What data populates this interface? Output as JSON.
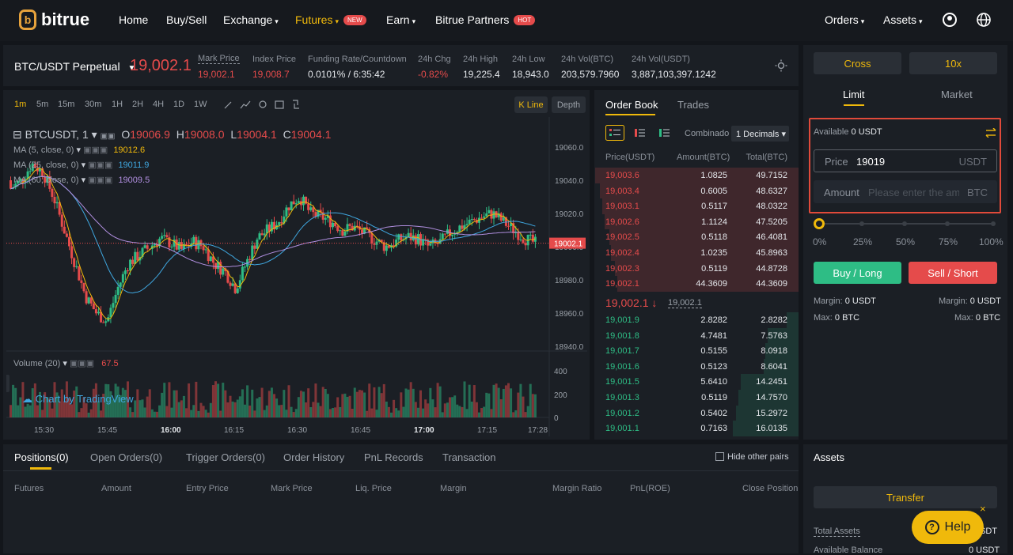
{
  "nav": {
    "logo": "bitrue",
    "home": "Home",
    "buysell": "Buy/Sell",
    "exchange": "Exchange",
    "futures": "Futures",
    "futures_badge": "NEW",
    "earn": "Earn",
    "partners": "Bitrue Partners",
    "partners_badge": "HOT",
    "orders": "Orders",
    "assets": "Assets"
  },
  "ticker": {
    "symbol": "BTC/USDT Perpetual",
    "last": "19,002.1",
    "mark_label": "Mark Price",
    "mark": "19,002.1",
    "index_label": "Index Price",
    "index": "19,008.7",
    "funding_label": "Funding Rate/Countdown",
    "funding": "0.0101% / 6:35:42",
    "chg_label": "24h Chg",
    "chg": "-0.82%",
    "high_label": "24h High",
    "high": "19,225.4",
    "low_label": "24h Low",
    "low": "18,943.0",
    "volbtc_label": "24h Vol(BTC)",
    "volbtc": "203,579.7960",
    "volusdt_label": "24h Vol(USDT)",
    "volusdt": "3,887,103,397.1242"
  },
  "chart": {
    "timeframes": [
      "1m",
      "5m",
      "15m",
      "30m",
      "1H",
      "2H",
      "4H",
      "1D",
      "1W"
    ],
    "kline": "K Line",
    "depth": "Depth",
    "title": "BTCUSDT, 1",
    "o_label": "O",
    "o": "19006.9",
    "h_label": "H",
    "h": "19008.0",
    "l_label": "L",
    "l": "19004.1",
    "c_label": "C",
    "c": "19004.1",
    "ma5": "MA (5, close, 0)",
    "ma5_val": "19012.6",
    "ma25": "MA (25, close, 0)",
    "ma25_val": "19011.9",
    "ma60": "MA (60, close, 0)",
    "ma60_val": "19009.5",
    "price_ticks": [
      "19060.0",
      "19040.0",
      "19020.0",
      "19000.0",
      "18980.0",
      "18960.0",
      "18940.0"
    ],
    "last_tag": "19002.1",
    "volume_label": "Volume (20)",
    "volume_val": "67.5",
    "vol_ticks": [
      "400",
      "200",
      "0"
    ],
    "time_ticks": [
      "15:30",
      "15:45",
      "16:00",
      "16:15",
      "16:30",
      "16:45",
      "17:00",
      "17:15",
      "17:28"
    ],
    "tv": "Chart by TradingView"
  },
  "orderbook": {
    "tab_book": "Order Book",
    "tab_trades": "Trades",
    "group": "Combinado",
    "decimals": "1 Decimals",
    "h_price": "Price(USDT)",
    "h_amount": "Amount(BTC)",
    "h_total": "Total(BTC)",
    "asks": [
      [
        "19,003.6",
        "1.0825",
        "49.7152"
      ],
      [
        "19,003.4",
        "0.6005",
        "48.6327"
      ],
      [
        "19,003.1",
        "0.5117",
        "48.0322"
      ],
      [
        "19,002.6",
        "1.1124",
        "47.5205"
      ],
      [
        "19,002.5",
        "0.5118",
        "46.4081"
      ],
      [
        "19,002.4",
        "1.0235",
        "45.8963"
      ],
      [
        "19,002.3",
        "0.5119",
        "44.8728"
      ],
      [
        "19,002.1",
        "44.3609",
        "44.3609"
      ]
    ],
    "mid": "19,002.1",
    "mid_mark": "19,002.1",
    "bids": [
      [
        "19,001.9",
        "2.8282",
        "2.8282"
      ],
      [
        "19,001.8",
        "4.7481",
        "7.5763"
      ],
      [
        "19,001.7",
        "0.5155",
        "8.0918"
      ],
      [
        "19,001.6",
        "0.5123",
        "8.6041"
      ],
      [
        "19,001.5",
        "5.6410",
        "14.2451"
      ],
      [
        "19,001.3",
        "0.5119",
        "14.7570"
      ],
      [
        "19,001.2",
        "0.5402",
        "15.2972"
      ],
      [
        "19,001.1",
        "0.7163",
        "16.0135"
      ]
    ]
  },
  "trade": {
    "cross": "Cross",
    "leverage": "10x",
    "limit": "Limit",
    "market": "Market",
    "available_label": "Available",
    "available": "0 USDT",
    "price_label": "Price",
    "price_value": "19019",
    "price_unit": "USDT",
    "amount_label": "Amount",
    "amount_placeholder": "Please enter the amount",
    "amount_unit": "BTC",
    "pcts": [
      "0%",
      "25%",
      "50%",
      "75%",
      "100%"
    ],
    "buy": "Buy / Long",
    "sell": "Sell / Short",
    "margin_label": "Margin:",
    "margin_buy": "0 USDT",
    "margin_sell": "0 USDT",
    "max_label": "Max:",
    "max_buy": "0 BTC",
    "max_sell": "0 BTC"
  },
  "positions": {
    "tabs": [
      "Positions(0)",
      "Open Orders(0)",
      "Trigger Orders(0)",
      "Order History",
      "PnL Records",
      "Transaction"
    ],
    "hide": "Hide other pairs",
    "cols": [
      "Futures",
      "Amount",
      "Entry Price",
      "Mark Price",
      "Liq. Price",
      "Margin",
      "Margin Ratio",
      "PnL(ROE)",
      "Close Position"
    ]
  },
  "assets": {
    "title": "Assets",
    "transfer": "Transfer",
    "total_label": "Total Assets",
    "total_suffix": "SDT",
    "avail_label": "Available Balance",
    "avail_val": "0 USDT"
  },
  "help": "Help",
  "colors": {
    "up": "#2ebd85",
    "down": "#e54b4b",
    "accent": "#f0b90b"
  }
}
